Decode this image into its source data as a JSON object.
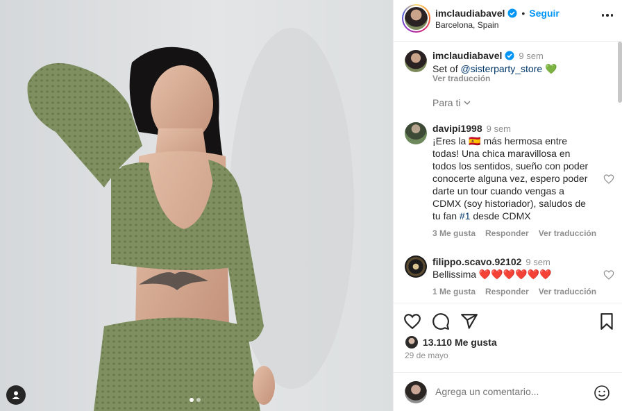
{
  "post": {
    "username": "imclaudiabavel",
    "follow_label": "Seguir",
    "location": "Barcelona, Spain",
    "caption_prefix": "Set of ",
    "caption_mention": "@sisterparty_store",
    "caption_emoji": "💚",
    "caption_time": "9 sem",
    "see_translation": "Ver traducción",
    "for_you": "Para ti",
    "media_dots": 2,
    "media_active_index": 0
  },
  "comments": [
    {
      "username": "davipi1998",
      "time": "9 sem",
      "text_before_flag": "¡Eres la ",
      "flag": "🇪🇸",
      "text_line1_after": " más hermosa entre",
      "text_lines": [
        "todas! Una chica maravillosa en",
        "todos los sentidos, sueño con poder",
        "conocerte alguna vez, espero poder",
        "darte un tour cuando vengas a",
        "CDMX (soy historiador), saludos de"
      ],
      "text_last_prefix": "tu fan ",
      "text_last_hashtag": "#1",
      "text_last_suffix": " desde CDMX",
      "likes": "3 Me gusta",
      "reply": "Responder",
      "translate": "Ver traducción"
    },
    {
      "username": "filippo.scavo.92102",
      "time": "9 sem",
      "text": "Bellissima ❤️❤️❤️❤️❤️❤️",
      "likes": "1 Me gusta",
      "reply": "Responder",
      "translate": "Ver traducción"
    }
  ],
  "stats": {
    "likes": "13.110 Me gusta",
    "date": "29 de mayo"
  },
  "composer": {
    "placeholder": "Agrega un comentario..."
  },
  "icons": {
    "verified": "verified-badge-icon",
    "more": "more-options-icon",
    "like": "heart-icon",
    "comment": "comment-icon",
    "share": "share-icon",
    "save": "bookmark-icon",
    "emoji": "emoji-icon",
    "tag": "user-tag-icon"
  },
  "colors": {
    "accent": "#0095f6",
    "mention": "#00376b",
    "muted": "#8e8e8e"
  }
}
